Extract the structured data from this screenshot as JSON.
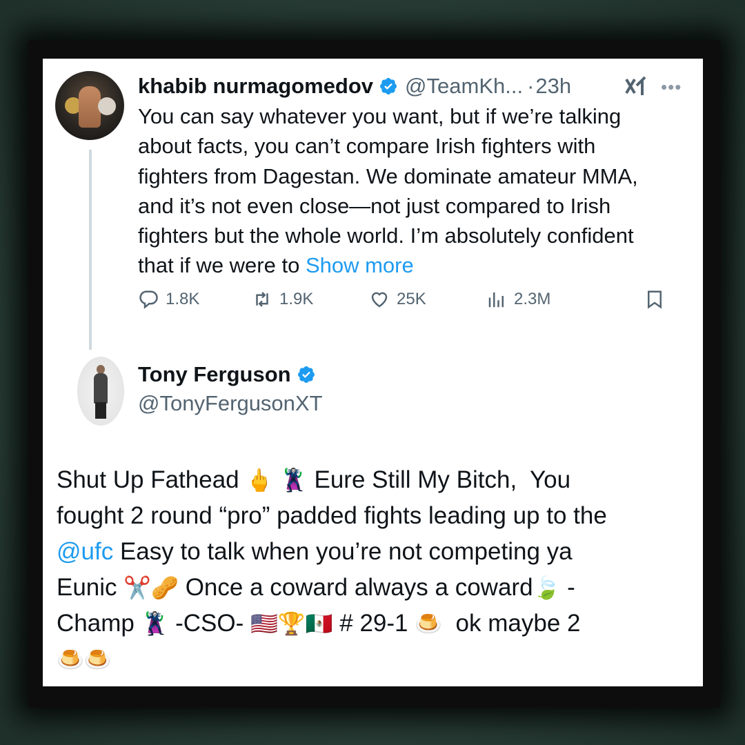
{
  "tweet": {
    "author_name": "khabib nurmagomedov",
    "handle": "@TeamKh...",
    "separator": "·",
    "time": "23h",
    "text_lines": [
      "You can say whatever you want, but if we’re talking",
      "about facts, you can’t compare Irish fighters with",
      "fighters from Dagestan. We dominate amateur MMA,",
      "and it’s not even close—not just compared to Irish",
      "fighters but the whole world. I’m absolutely confident",
      "that if we were to "
    ],
    "show_more": "Show more",
    "replies": "1.8K",
    "reposts": "1.9K",
    "likes": "25K",
    "views": "2.3M",
    "icons": {
      "verified": "verified-badge-icon",
      "grok": "grok-icon",
      "more": "more-dots-icon",
      "reply": "reply-icon",
      "repost": "repost-icon",
      "like": "heart-icon",
      "views": "views-chart-icon",
      "bookmark": "bookmark-icon",
      "share": "share-icon"
    }
  },
  "reply": {
    "author_name": "Tony Ferguson",
    "handle": "@TonyFergusonXT",
    "line1_a": "Shut Up Fathead ",
    "emoji_finger": "🖕",
    "emoji_villain": "🦹",
    "line1_b": " Eure Still My Bitch,  You",
    "line2": "fought 2 round “pro” padded fights leading up to the",
    "mention": "@ufc",
    "line3_rest": " Easy to talk when you’re not competing ya",
    "line4_a": "Eunic ",
    "emoji_scissors": "✂️",
    "emoji_peanut": "🥜",
    "line4_b": " Once a coward always a coward",
    "emoji_leaves": "🍃",
    "line4_c": " -",
    "line5_a": "Champ ",
    "line5_b": " -CSO- ",
    "emoji_us": "🇺🇸",
    "emoji_trophy": "🏆",
    "emoji_mx": "🇲🇽",
    "line5_c": " # 29-1 ",
    "emoji_flan": "🍮",
    "line5_d": "  ok maybe 2"
  },
  "colors": {
    "link": "#1d9bf0",
    "verified": "#1d9bf0",
    "text": "#0f1419",
    "muted": "#536471"
  }
}
